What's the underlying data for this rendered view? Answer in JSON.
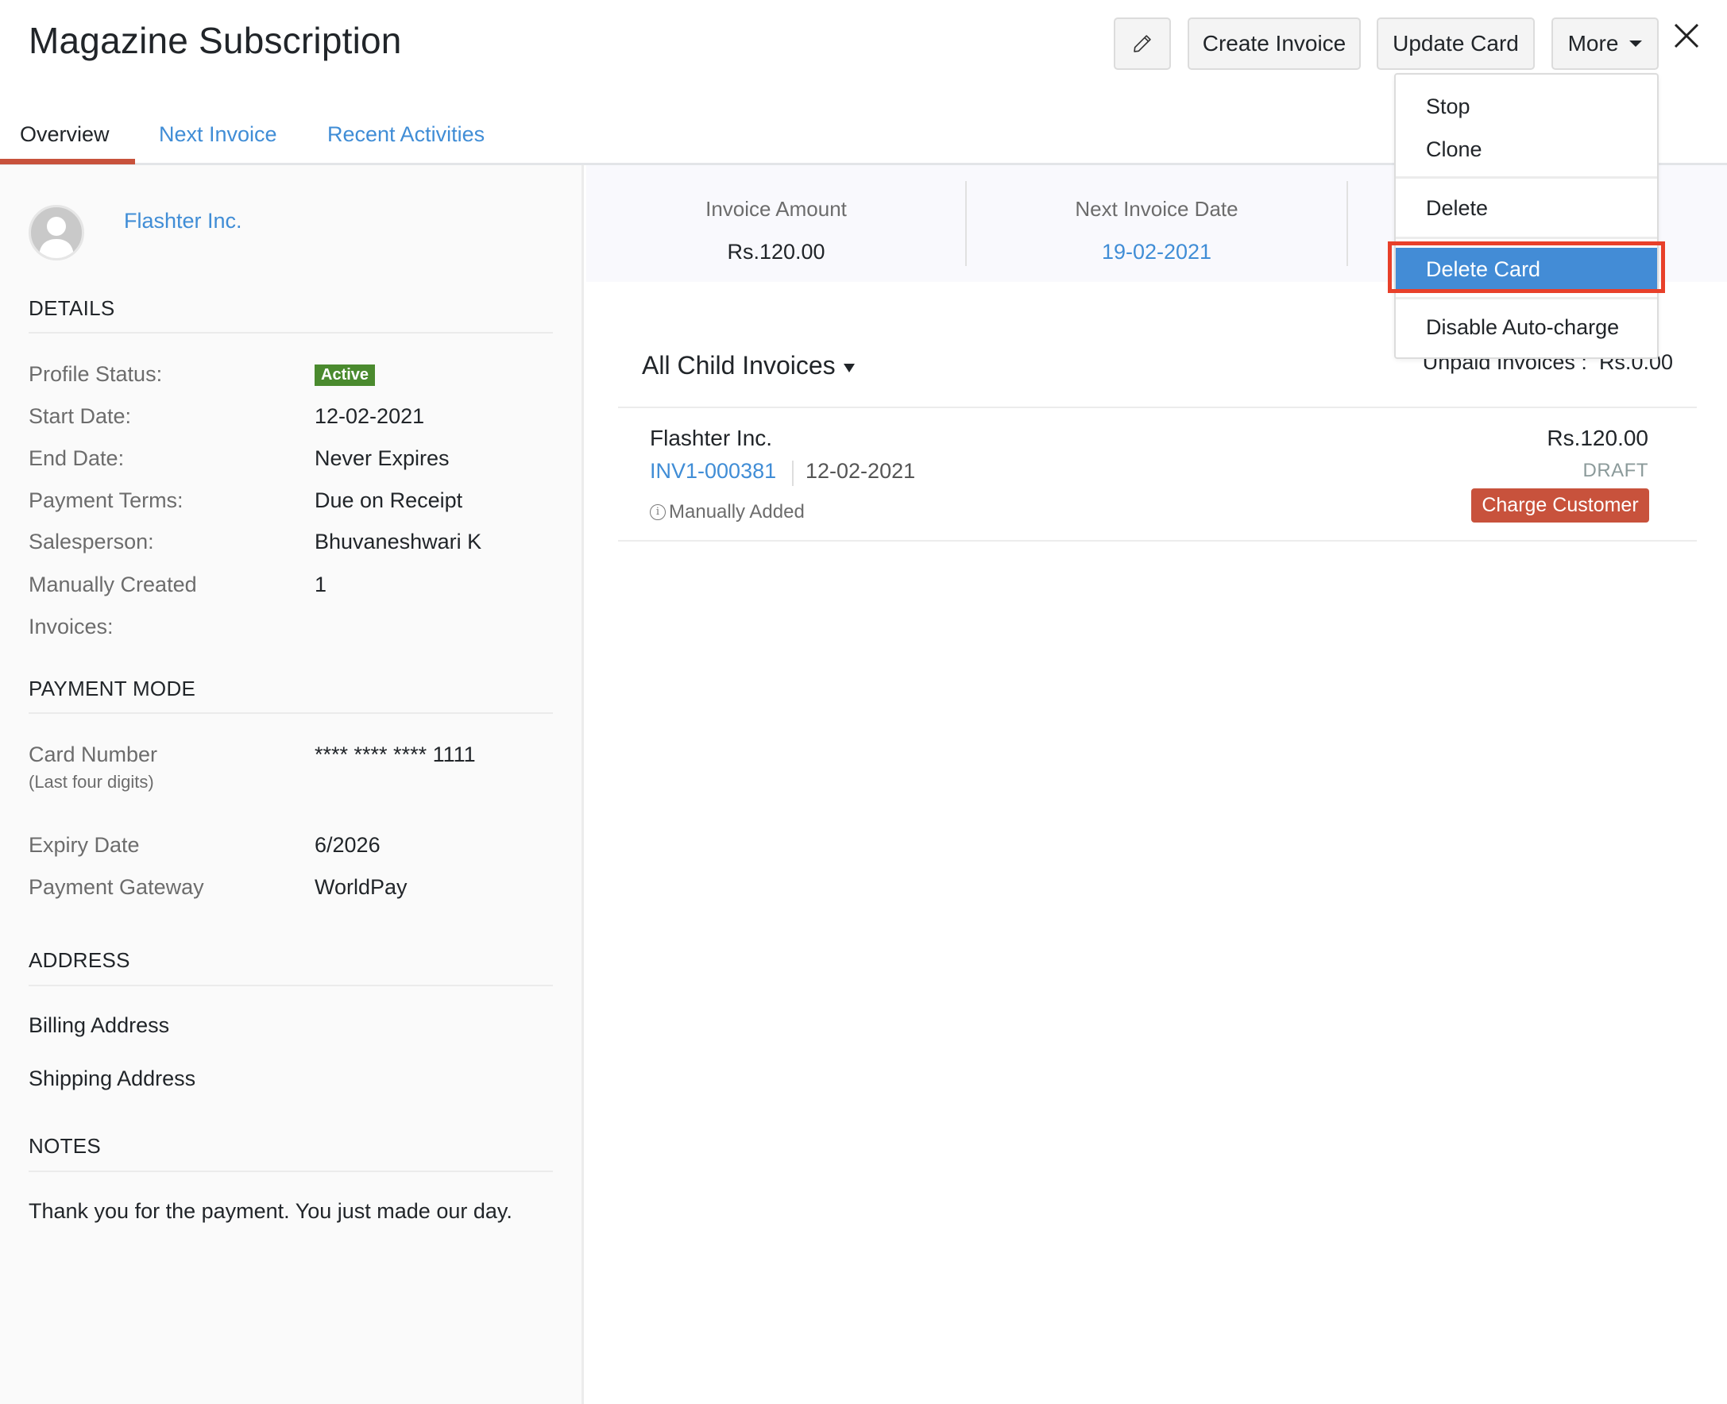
{
  "header": {
    "title": "Magazine Subscription",
    "buttons": {
      "edit_icon": "pencil-icon",
      "create_invoice": "Create Invoice",
      "update_card": "Update Card",
      "more": "More",
      "close_icon": "close-icon"
    }
  },
  "tabs": [
    {
      "label": "Overview",
      "active": true
    },
    {
      "label": "Next Invoice",
      "active": false
    },
    {
      "label": "Recent Activities",
      "active": false
    }
  ],
  "more_menu": {
    "items": [
      {
        "label": "Stop"
      },
      {
        "label": "Clone"
      },
      {
        "label": "Delete"
      },
      {
        "label": "Delete Card",
        "highlighted": true
      },
      {
        "label": "Disable Auto-charge"
      }
    ],
    "highlight_color": "#e8402a"
  },
  "customer": {
    "name": "Flashter Inc.",
    "avatar_icon": "user-avatar-icon"
  },
  "details": {
    "heading": "DETAILS",
    "rows": [
      {
        "label": "Profile Status:",
        "value": "Active"
      },
      {
        "label": "Start Date:",
        "value": "12-02-2021"
      },
      {
        "label": "End Date:",
        "value": "Never Expires"
      },
      {
        "label": "Payment Terms:",
        "value": "Due on Receipt"
      },
      {
        "label": "Salesperson:",
        "value": "Bhuvaneshwari K"
      },
      {
        "label": "Manually Created Invoices:",
        "label_line1": "Manually Created",
        "label_line2": "Invoices:",
        "value": "1"
      }
    ]
  },
  "payment_mode": {
    "heading": "PAYMENT MODE",
    "card_number_label": "Card Number",
    "card_number_sublabel": "(Last four digits)",
    "card_number": "**** **** **** 1111",
    "expiry_label": "Expiry Date",
    "expiry": "6/2026",
    "gateway_label": "Payment Gateway",
    "gateway": "WorldPay"
  },
  "address": {
    "heading": "ADDRESS",
    "billing": "Billing Address",
    "shipping": "Shipping Address"
  },
  "notes": {
    "heading": "NOTES",
    "text": "Thank you for the payment. You just made our day."
  },
  "summary": [
    {
      "label": "Invoice Amount",
      "value": "Rs.120.00"
    },
    {
      "label": "Next Invoice Date",
      "value": "19-02-2021"
    }
  ],
  "child_invoices": {
    "filter_label": "All Child Invoices",
    "unpaid_label": "Unpaid Invoices :",
    "unpaid_value": "Rs.0.00",
    "items": [
      {
        "customer": "Flashter Inc.",
        "number": "INV1-000381",
        "date": "12-02-2021",
        "note": "Manually Added",
        "amount": "Rs.120.00",
        "status": "DRAFT",
        "action": "Charge Customer"
      }
    ]
  },
  "colors": {
    "accent_blue": "#408dd6",
    "tab_active": "#c8523c",
    "badge_active": "#4a8a2e",
    "charge_button": "#c8523c",
    "menu_highlight": "#438cd6"
  }
}
